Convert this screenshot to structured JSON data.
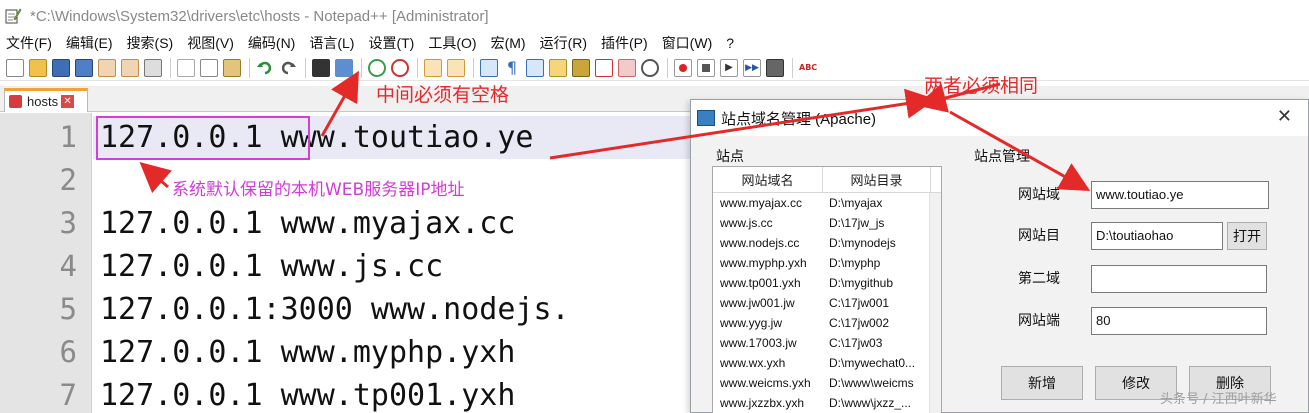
{
  "window": {
    "title": "*C:\\Windows\\System32\\drivers\\etc\\hosts - Notepad++ [Administrator]"
  },
  "menubar": {
    "items": [
      "文件(F)",
      "编辑(E)",
      "搜索(S)",
      "视图(V)",
      "编码(N)",
      "语言(L)",
      "设置(T)",
      "工具(O)",
      "宏(M)",
      "运行(R)",
      "插件(P)",
      "窗口(W)",
      "?"
    ]
  },
  "tabs": [
    {
      "label": "hosts",
      "close": "✕"
    }
  ],
  "editor": {
    "line_numbers": [
      "1",
      "2",
      "3",
      "4",
      "5",
      "6",
      "7"
    ],
    "lines": [
      "127.0.0.1 www.toutiao.ye",
      "",
      "127.0.0.1 www.myajax.cc",
      "127.0.0.1 www.js.cc",
      "127.0.0.1:3000 www.nodejs.",
      "127.0.0.1 www.myphp.yxh",
      "127.0.0.1 www.tp001.yxh"
    ]
  },
  "annotations": {
    "space_note": "中间必须有空格",
    "same_note": "两者必须相同",
    "reserved_note": "系统默认保留的本机WEB服务器IP地址",
    "color_red": "#e42929",
    "color_magenta": "#d23fd6"
  },
  "dialog": {
    "title": "站点域名管理 (Apache)",
    "close": "✕",
    "sites_group": "站点",
    "manage_group": "站点管理",
    "list": {
      "headers": [
        "网站域名",
        "网站目录"
      ],
      "rows": [
        [
          "www.myajax.cc",
          "D:\\myajax"
        ],
        [
          "www.js.cc",
          "D:\\17jw_js"
        ],
        [
          "www.nodejs.cc",
          "D:\\mynodejs"
        ],
        [
          "www.myphp.yxh",
          "D:\\myphp"
        ],
        [
          "www.tp001.yxh",
          "D:\\mygithub"
        ],
        [
          "www.jw001.jw",
          "C:\\17jw001"
        ],
        [
          "www.yyg.jw",
          "C:\\17jw002"
        ],
        [
          "www.17003.jw",
          "C:\\17jw03"
        ],
        [
          "www.wx.yxh",
          "D:\\mywechat0..."
        ],
        [
          "www.weicms.yxh",
          "D:\\www\\weicms"
        ],
        [
          "www.jxzzbx.yxh",
          "D:\\www\\jxzz_..."
        ]
      ]
    },
    "form": {
      "domain_label": "网站域",
      "domain_value": "www.toutiao.ye",
      "dir_label": "网站目",
      "dir_value": "D:\\toutiaohao",
      "open_button": "打开",
      "second_label": "第二域",
      "second_value": "",
      "port_label": "网站端",
      "port_value": "80"
    },
    "buttons": {
      "add": "新增",
      "edit": "修改",
      "delete": "删除"
    }
  },
  "watermark": "头条号 / 江西叶新华"
}
